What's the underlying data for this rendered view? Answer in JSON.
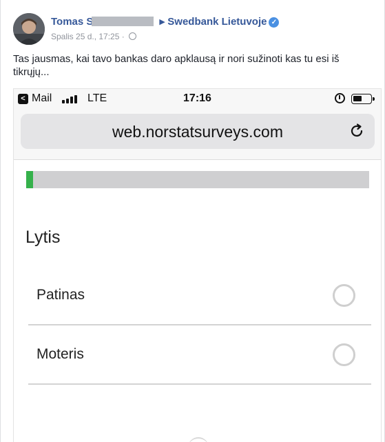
{
  "post": {
    "author": "Tomas S",
    "page_name": "Swedbank Lietuvoje",
    "timestamp": "Spalis 25 d., 17:25 ·",
    "text": "Tas jausmas, kai tavo bankas daro apklausą ir nori sužinoti kas tu esi iš tikrųjų..."
  },
  "icons": {
    "verified": "verified-check-icon",
    "audience": "globe-icon",
    "reload": "reload-icon",
    "back": "back-arrow-icon",
    "alarm": "alarm-icon"
  },
  "phone": {
    "status": {
      "back_app": "Mail",
      "network": "LTE",
      "time": "17:16"
    },
    "url": "web.norstatsurveys.com",
    "progress_fraction": 0.02,
    "colors": {
      "progress_fill": "#35b14b",
      "progress_track": "#cfcfd1",
      "link": "#365899"
    },
    "survey": {
      "question": "Lytis",
      "options": [
        {
          "label": "Patinas",
          "selected": false
        },
        {
          "label": "Moteris",
          "selected": false
        }
      ]
    }
  }
}
